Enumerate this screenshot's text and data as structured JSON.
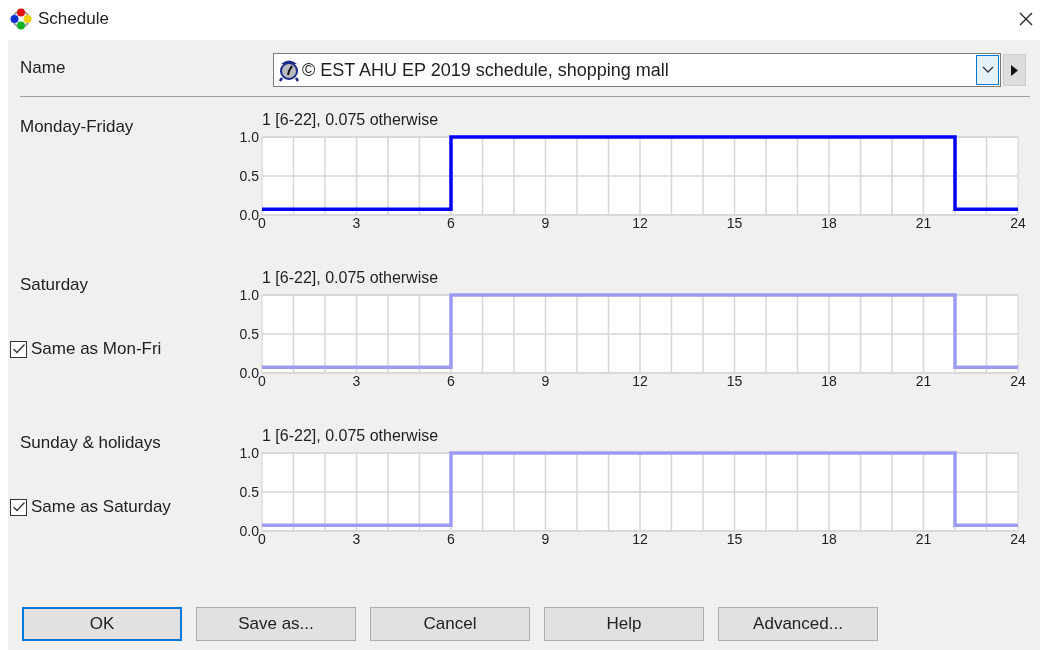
{
  "window": {
    "title": "Schedule"
  },
  "name_field": {
    "label": "Name",
    "value": "© EST AHU EP 2019 schedule, shopping mall"
  },
  "sections": [
    {
      "label": "Monday-Friday",
      "chart_data": {
        "type": "line",
        "title": "1 [6-22], 0.075 otherwise",
        "x": [
          0,
          6,
          6,
          22,
          22,
          24
        ],
        "grid": true,
        "series": [
          {
            "color": "#0000ff",
            "values": [
              0.075,
              0.075,
              1,
              1,
              0.075,
              0.075
            ]
          }
        ],
        "xlim": [
          0,
          24
        ],
        "ylim": [
          0,
          1
        ],
        "xticks": [
          0,
          3,
          6,
          9,
          12,
          15,
          18,
          21,
          24
        ],
        "yticks": [
          {
            "value": 0,
            "label": "0.0"
          },
          {
            "value": 0.5,
            "label": "0.5"
          },
          {
            "value": 1,
            "label": "1.0"
          }
        ]
      }
    },
    {
      "label": "Saturday",
      "checkbox": {
        "label": "Same as Mon-Fri",
        "checked": true
      },
      "chart_data": {
        "type": "line",
        "title": "1 [6-22], 0.075 otherwise",
        "x": [
          0,
          6,
          6,
          22,
          22,
          24
        ],
        "grid": true,
        "series": [
          {
            "color": "#9b9bf2",
            "values": [
              0.075,
              0.075,
              1,
              1,
              0.075,
              0.075
            ]
          }
        ],
        "xlim": [
          0,
          24
        ],
        "ylim": [
          0,
          1
        ],
        "xticks": [
          0,
          3,
          6,
          9,
          12,
          15,
          18,
          21,
          24
        ],
        "yticks": [
          {
            "value": 0,
            "label": "0.0"
          },
          {
            "value": 0.5,
            "label": "0.5"
          },
          {
            "value": 1,
            "label": "1.0"
          }
        ]
      }
    },
    {
      "label": "Sunday & holidays",
      "checkbox": {
        "label": "Same as Saturday",
        "checked": true
      },
      "chart_data": {
        "type": "line",
        "title": "1 [6-22], 0.075 otherwise",
        "x": [
          0,
          6,
          6,
          22,
          22,
          24
        ],
        "grid": true,
        "series": [
          {
            "color": "#9b9bf2",
            "values": [
              0.075,
              0.075,
              1,
              1,
              0.075,
              0.075
            ]
          }
        ],
        "xlim": [
          0,
          24
        ],
        "ylim": [
          0,
          1
        ],
        "xticks": [
          0,
          3,
          6,
          9,
          12,
          15,
          18,
          21,
          24
        ],
        "yticks": [
          {
            "value": 0,
            "label": "0.0"
          },
          {
            "value": 0.5,
            "label": "0.5"
          },
          {
            "value": 1,
            "label": "1.0"
          }
        ]
      }
    }
  ],
  "buttons": [
    {
      "label": "OK",
      "selected": true
    },
    {
      "label": "Save as...",
      "selected": false
    },
    {
      "label": "Cancel",
      "selected": false
    },
    {
      "label": "Help",
      "selected": false
    },
    {
      "label": "Advanced...",
      "selected": false
    }
  ]
}
